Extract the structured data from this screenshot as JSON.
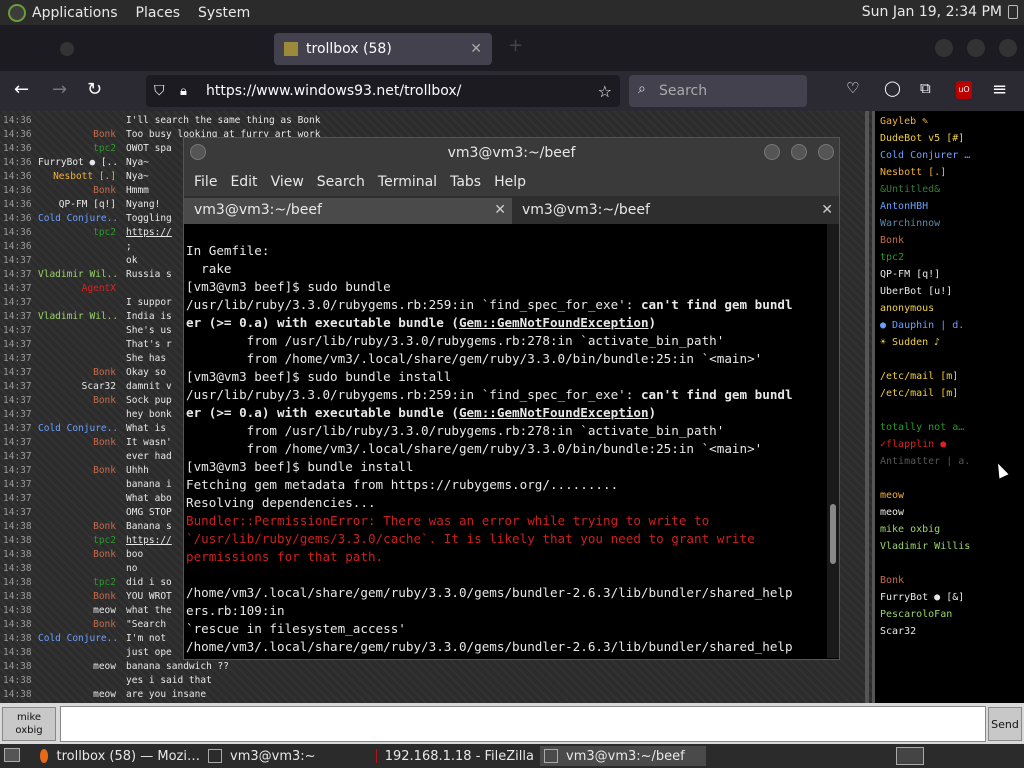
{
  "top_panel": {
    "menus": [
      "Applications",
      "Places",
      "System"
    ],
    "clock": "Sun Jan 19,  2:34 PM"
  },
  "browser": {
    "tabs": [
      {
        "label": "",
        "active": false
      },
      {
        "label": "trollbox (58)",
        "active": true
      }
    ],
    "url": "https://www.windows93.net/trollbox/",
    "search_placeholder": "Search"
  },
  "chat": {
    "messages": [
      {
        "time": "14:36",
        "nick": "",
        "nick_color": "#2222bb",
        "text": "I'll search the same thing as Bonk"
      },
      {
        "time": "14:36",
        "nick": "Bonk",
        "nick_color": "#c86a4a",
        "text": "Too busy looking at furry art work"
      },
      {
        "time": "14:36",
        "nick": "tpc2",
        "nick_color": "#2a9a2a",
        "text": "OWOT spa"
      },
      {
        "time": "14:36",
        "nick": "FurryBot ● [..",
        "nick_color": "#e8e8e8",
        "text": "Nya~"
      },
      {
        "time": "14:36",
        "nick": "Nesbott [.]",
        "nick_color": "#f0b040",
        "text": "Nya~"
      },
      {
        "time": "14:36",
        "nick": "Bonk",
        "nick_color": "#c86a4a",
        "text": "Hmmm"
      },
      {
        "time": "14:36",
        "nick": "QP-FM [q!]",
        "nick_color": "#e8e8e8",
        "text": "Nyang!"
      },
      {
        "time": "14:36",
        "nick": "Cold Conjure..",
        "nick_color": "#6aa0ff",
        "text": "Toggling"
      },
      {
        "time": "14:36",
        "nick": "tpc2",
        "nick_color": "#2a9a2a",
        "text": "https://"
      },
      {
        "time": "14:36",
        "nick": "",
        "nick_color": "#e8e8e8",
        "text": ";"
      },
      {
        "time": "14:37",
        "nick": "",
        "nick_color": "#2222bb",
        "text": "ok"
      },
      {
        "time": "14:37",
        "nick": "Vladimir Wil..",
        "nick_color": "#9ad46a",
        "text": "Russia s"
      },
      {
        "time": "14:37",
        "nick": "AgentX",
        "nick_color": "#dd2222",
        "text": ""
      },
      {
        "time": "14:37",
        "nick": "",
        "nick_color": "#2222bb",
        "text": "I suppor"
      },
      {
        "time": "14:37",
        "nick": "Vladimir Wil..",
        "nick_color": "#9ad46a",
        "text": "India is"
      },
      {
        "time": "14:37",
        "nick": "",
        "nick_color": "#2222bb",
        "text": "She's us"
      },
      {
        "time": "14:37",
        "nick": "",
        "nick_color": "#2222bb",
        "text": "That's r"
      },
      {
        "time": "14:37",
        "nick": "",
        "nick_color": "#2222bb",
        "text": "She has"
      },
      {
        "time": "14:37",
        "nick": "Bonk",
        "nick_color": "#c86a4a",
        "text": "Okay so"
      },
      {
        "time": "14:37",
        "nick": "Scar32",
        "nick_color": "#e8e8e8",
        "text": "damnit v"
      },
      {
        "time": "14:37",
        "nick": "Bonk",
        "nick_color": "#c86a4a",
        "text": "Sock pup"
      },
      {
        "time": "14:37",
        "nick": "",
        "nick_color": "#bb2222",
        "text": "hey bonk"
      },
      {
        "time": "14:37",
        "nick": "Cold Conjure..",
        "nick_color": "#6aa0ff",
        "text": "What is"
      },
      {
        "time": "14:37",
        "nick": "Bonk",
        "nick_color": "#c86a4a",
        "text": "It wasn'"
      },
      {
        "time": "14:37",
        "nick": "",
        "nick_color": "#bb2222",
        "text": "ever had"
      },
      {
        "time": "14:37",
        "nick": "Bonk",
        "nick_color": "#c86a4a",
        "text": "Uhhh"
      },
      {
        "time": "14:37",
        "nick": "",
        "nick_color": "#bb2222",
        "text": "banana i"
      },
      {
        "time": "14:37",
        "nick": "",
        "nick_color": "#2222bb",
        "text": "What abo"
      },
      {
        "time": "14:37",
        "nick": "",
        "nick_color": "#bb2222",
        "text": "OMG STOP"
      },
      {
        "time": "14:38",
        "nick": "Bonk",
        "nick_color": "#c86a4a",
        "text": "Banana s"
      },
      {
        "time": "14:38",
        "nick": "tpc2",
        "nick_color": "#2a9a2a",
        "text": "https://"
      },
      {
        "time": "14:38",
        "nick": "Bonk",
        "nick_color": "#c86a4a",
        "text": "boo"
      },
      {
        "time": "14:38",
        "nick": "",
        "nick_color": "#bb2222",
        "text": "no"
      },
      {
        "time": "14:38",
        "nick": "tpc2",
        "nick_color": "#2a9a2a",
        "text": "did i so"
      },
      {
        "time": "14:38",
        "nick": "Bonk",
        "nick_color": "#c86a4a",
        "text": "YOU WROT"
      },
      {
        "time": "14:38",
        "nick": "meow",
        "nick_color": "#e8e8e8",
        "text": "what the"
      },
      {
        "time": "14:38",
        "nick": "Bonk",
        "nick_color": "#c86a4a",
        "text": "\"Search"
      },
      {
        "time": "14:38",
        "nick": "Cold Conjure..",
        "nick_color": "#6aa0ff",
        "text": "I'm not"
      },
      {
        "time": "14:38",
        "nick": "",
        "nick_color": "#bb2222",
        "text": "just ope"
      },
      {
        "time": "14:38",
        "nick": "meow",
        "nick_color": "#e8e8e8",
        "text": "banana sandwich ??"
      },
      {
        "time": "14:38",
        "nick": "",
        "nick_color": "#bb2222",
        "text": "yes i said that"
      },
      {
        "time": "14:38",
        "nick": "meow",
        "nick_color": "#e8e8e8",
        "text": "are you insane"
      }
    ]
  },
  "userlist": [
    {
      "name": "Gayleb ✎",
      "color": "#f0b040"
    },
    {
      "name": "DudeBot v5 [#]",
      "color": "#f0d040"
    },
    {
      "name": "Cold Conjurer …",
      "color": "#6aa0ff"
    },
    {
      "name": "Nesbott [.]",
      "color": "#f0b040"
    },
    {
      "name": "&Untitled&",
      "color": "#3a7a3a"
    },
    {
      "name": "AntonHBH",
      "color": "#6aa0ff"
    },
    {
      "name": "Warchinnow",
      "color": "#5a8aaa"
    },
    {
      "name": "Bonk",
      "color": "#c86a4a"
    },
    {
      "name": "tpc2",
      "color": "#2a9a2a"
    },
    {
      "name": "QP-FM [q!]",
      "color": "#e8e8e8"
    },
    {
      "name": "UberBot [u!]",
      "color": "#e8e8e8"
    },
    {
      "name": "anonymous",
      "color": "#f0d040"
    },
    {
      "name": "● Dauphin | d.",
      "color": "#6aa0ff"
    },
    {
      "name": "☀ Sudden ♪",
      "color": "#f0d040"
    },
    {
      "name": "",
      "color": "#2222bb"
    },
    {
      "name": "/etc/mail [m]",
      "color": "#f0d040"
    },
    {
      "name": "/etc/mail [m]",
      "color": "#f0d040"
    },
    {
      "name": "",
      "color": "#2222bb"
    },
    {
      "name": "totally not a…",
      "color": "#2a9a2a"
    },
    {
      "name": "✓flapplin ●",
      "color": "#dd2222"
    },
    {
      "name": "Antimatter | a.",
      "color": "#555555"
    },
    {
      "name": "",
      "color": "#bb2222"
    },
    {
      "name": "meow",
      "color": "#f0b040"
    },
    {
      "name": "meow",
      "color": "#e8e8e8"
    },
    {
      "name": "mike oxbig",
      "color": "#9ad46a"
    },
    {
      "name": "Vladimir Willis",
      "color": "#9ad46a"
    },
    {
      "name": "",
      "color": "#2222bb"
    },
    {
      "name": "Bonk",
      "color": "#c86a4a"
    },
    {
      "name": "FurryBot ● [&]",
      "color": "#e8e8e8"
    },
    {
      "name": "PescaroloFan",
      "color": "#9ad46a"
    },
    {
      "name": "Scar32",
      "color": "#e8e8e8"
    }
  ],
  "input": {
    "nick_label_1": "mike",
    "nick_label_2": "oxbig",
    "send_label": "Send"
  },
  "terminal": {
    "title": "vm3@vm3:~/beef",
    "menus": [
      "File",
      "Edit",
      "View",
      "Search",
      "Terminal",
      "Tabs",
      "Help"
    ],
    "tabs": [
      "vm3@vm3:~/beef",
      "vm3@vm3:~/beef"
    ],
    "lines": [
      {
        "parts": [
          {
            "t": "",
            "c": ""
          }
        ]
      },
      {
        "parts": [
          {
            "t": "In Gemfile:",
            "c": ""
          }
        ]
      },
      {
        "parts": [
          {
            "t": "  rake",
            "c": ""
          }
        ]
      },
      {
        "parts": [
          {
            "t": "[vm3@vm3 beef]$ sudo bundle",
            "c": ""
          }
        ]
      },
      {
        "parts": [
          {
            "t": "/usr/lib/ruby/3.3.0/rubygems.rb:259:in `find_spec_for_exe': ",
            "c": ""
          },
          {
            "t": "can't find gem bundl",
            "c": "b"
          }
        ]
      },
      {
        "parts": [
          {
            "t": "er (>= 0.a) with executable bundle (",
            "c": "b"
          },
          {
            "t": "Gem::GemNotFoundException",
            "c": "u"
          },
          {
            "t": ")",
            "c": "b"
          }
        ]
      },
      {
        "parts": [
          {
            "t": "        from /usr/lib/ruby/3.3.0/rubygems.rb:278:in `activate_bin_path'",
            "c": ""
          }
        ]
      },
      {
        "parts": [
          {
            "t": "        from /home/vm3/.local/share/gem/ruby/3.3.0/bin/bundle:25:in `<main>'",
            "c": ""
          }
        ]
      },
      {
        "parts": [
          {
            "t": "[vm3@vm3 beef]$ sudo bundle install",
            "c": ""
          }
        ]
      },
      {
        "parts": [
          {
            "t": "/usr/lib/ruby/3.3.0/rubygems.rb:259:in `find_spec_for_exe': ",
            "c": ""
          },
          {
            "t": "can't find gem bundl",
            "c": "b"
          }
        ]
      },
      {
        "parts": [
          {
            "t": "er (>= 0.a) with executable bundle (",
            "c": "b"
          },
          {
            "t": "Gem::GemNotFoundException",
            "c": "u"
          },
          {
            "t": ")",
            "c": "b"
          }
        ]
      },
      {
        "parts": [
          {
            "t": "        from /usr/lib/ruby/3.3.0/rubygems.rb:278:in `activate_bin_path'",
            "c": ""
          }
        ]
      },
      {
        "parts": [
          {
            "t": "        from /home/vm3/.local/share/gem/ruby/3.3.0/bin/bundle:25:in `<main>'",
            "c": ""
          }
        ]
      },
      {
        "parts": [
          {
            "t": "[vm3@vm3 beef]$ bundle install",
            "c": ""
          }
        ]
      },
      {
        "parts": [
          {
            "t": "Fetching gem metadata from https://rubygems.org/.........",
            "c": ""
          }
        ]
      },
      {
        "parts": [
          {
            "t": "Resolving dependencies...",
            "c": ""
          }
        ]
      },
      {
        "parts": [
          {
            "t": "Bundler::PermissionError: There was an error while trying to write to",
            "c": "red"
          }
        ]
      },
      {
        "parts": [
          {
            "t": "`/usr/lib/ruby/gems/3.3.0/cache`. It is likely that you need to grant write",
            "c": "red"
          }
        ]
      },
      {
        "parts": [
          {
            "t": "permissions for that path.",
            "c": "red"
          }
        ]
      },
      {
        "parts": [
          {
            "t": "",
            "c": ""
          }
        ]
      },
      {
        "parts": [
          {
            "t": "/home/vm3/.local/share/gem/ruby/3.3.0/gems/bundler-2.6.3/lib/bundler/shared_help",
            "c": ""
          }
        ]
      },
      {
        "parts": [
          {
            "t": "ers.rb:109:in",
            "c": ""
          }
        ]
      },
      {
        "parts": [
          {
            "t": "`rescue in filesystem_access'",
            "c": ""
          }
        ]
      },
      {
        "parts": [
          {
            "t": "/home/vm3/.local/share/gem/ruby/3.3.0/gems/bundler-2.6.3/lib/bundler/shared_help",
            "c": ""
          }
        ]
      }
    ]
  },
  "taskbar": {
    "tasks": [
      {
        "label": "trollbox (58) — Mozi…",
        "active": false
      },
      {
        "label": "vm3@vm3:~",
        "active": false
      },
      {
        "label": "192.168.1.18 - FileZilla",
        "active": false
      },
      {
        "label": "vm3@vm3:~/beef",
        "active": true
      }
    ]
  }
}
